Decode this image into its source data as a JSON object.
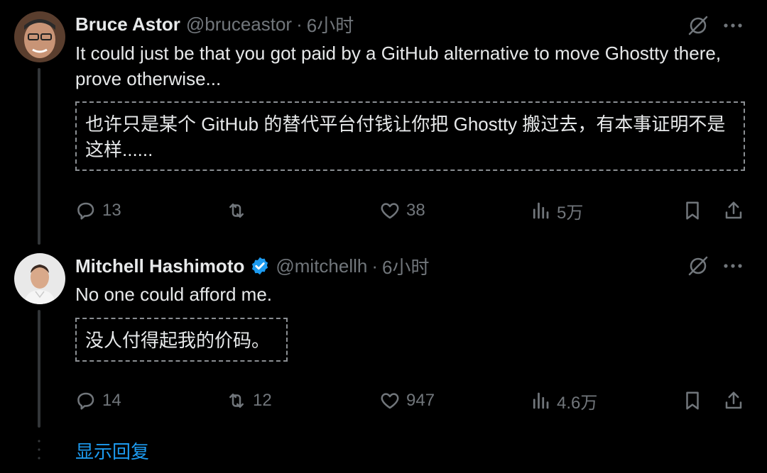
{
  "tweet1": {
    "name": "Bruce Astor",
    "handle": "@bruceastor",
    "separator": "·",
    "time": "6小时",
    "text": "It could just be that you got paid by a GitHub alternative to move Ghostty there, prove otherwise...",
    "translation": "也许只是某个 GitHub 的替代平台付钱让你把 Ghostty 搬过去，有本事证明不是这样......",
    "replies": "13",
    "retweets": "",
    "likes": "38",
    "views": "5万"
  },
  "tweet2": {
    "name": "Mitchell Hashimoto",
    "handle": "@mitchellh",
    "separator": "·",
    "time": "6小时",
    "text": "No one could afford me.",
    "translation": "没人付得起我的价码。",
    "replies": "14",
    "retweets": "12",
    "likes": "947",
    "views": "4.6万"
  },
  "show_replies_label": "显示回复",
  "colors": {
    "background": "#000000",
    "text": "#e7e9ea",
    "muted": "#71767b",
    "accent": "#1d9bf0",
    "verified": "#1d9bf0"
  },
  "icons": [
    "grok-icon",
    "more-icon",
    "reply-icon",
    "retweet-icon",
    "like-icon",
    "views-icon",
    "bookmark-icon",
    "share-icon",
    "verified-badge-icon"
  ]
}
